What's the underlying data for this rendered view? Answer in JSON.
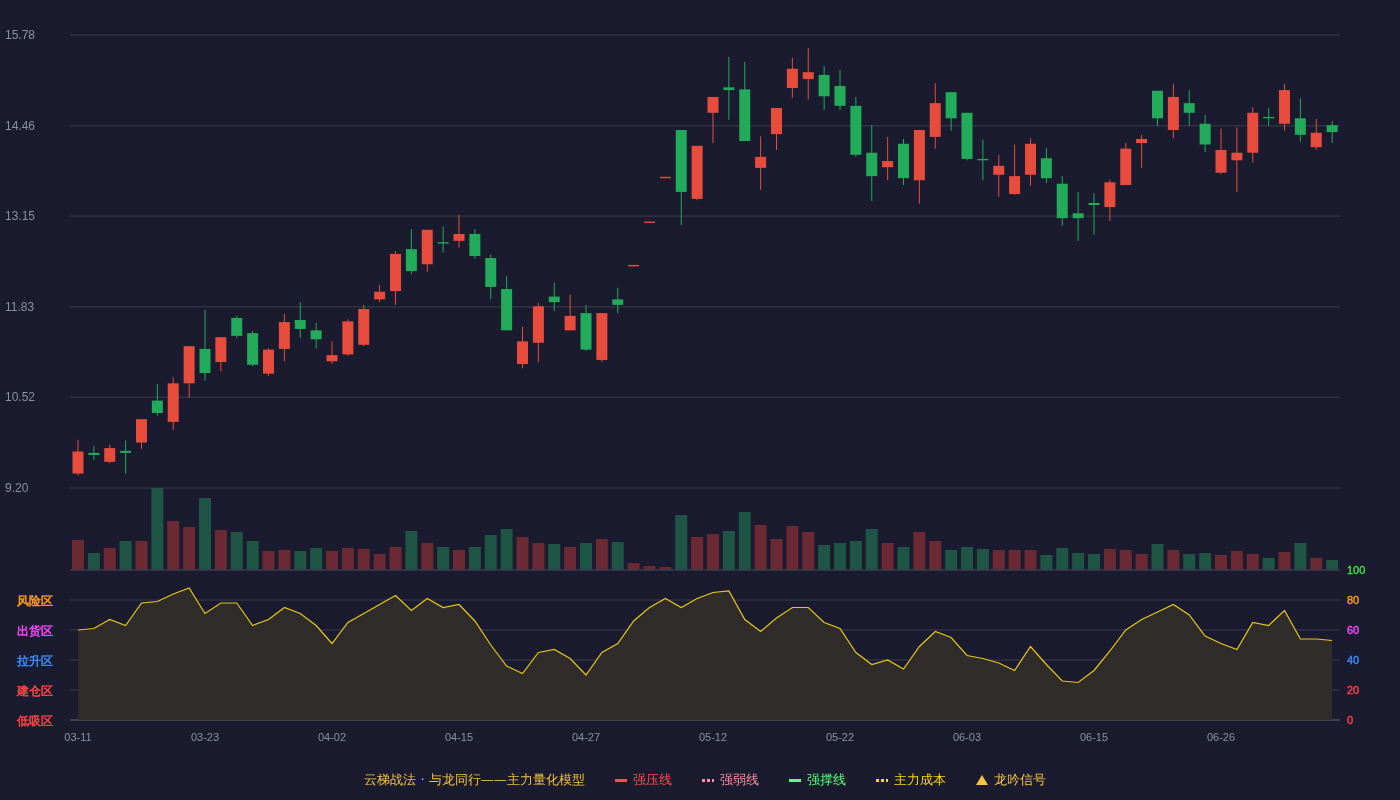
{
  "price_chart": {
    "chart_data": {
      "type": "candlestick",
      "grid": true,
      "ylim": [
        9.2,
        15.78
      ],
      "yticks": [
        {
          "value": 9.2,
          "label": "9.20"
        },
        {
          "value": 10.52,
          "label": "10.52"
        },
        {
          "value": 11.83,
          "label": "11.83"
        },
        {
          "value": 13.15,
          "label": "13.15"
        },
        {
          "value": 14.46,
          "label": "14.46"
        },
        {
          "value": 15.78,
          "label": "15.78"
        }
      ],
      "ohlc": [
        [
          9.41,
          9.9,
          9.38,
          9.73
        ],
        [
          9.71,
          9.81,
          9.61,
          9.68
        ],
        [
          9.58,
          9.83,
          9.56,
          9.78
        ],
        [
          9.74,
          9.89,
          9.41,
          9.71
        ],
        [
          9.86,
          10.2,
          9.77,
          10.2
        ],
        [
          10.47,
          10.71,
          10.25,
          10.29
        ],
        [
          10.16,
          10.81,
          10.04,
          10.72
        ],
        [
          10.72,
          11.26,
          10.51,
          11.26
        ],
        [
          11.22,
          11.79,
          10.76,
          10.87
        ],
        [
          11.03,
          11.39,
          10.89,
          11.39
        ],
        [
          11.67,
          11.7,
          11.38,
          11.41
        ],
        [
          11.45,
          11.48,
          10.97,
          10.99
        ],
        [
          10.86,
          11.23,
          10.83,
          11.21
        ],
        [
          11.22,
          11.73,
          11.04,
          11.61
        ],
        [
          11.64,
          11.9,
          11.38,
          11.51
        ],
        [
          11.49,
          11.6,
          11.23,
          11.36
        ],
        [
          11.04,
          11.33,
          11.0,
          11.13
        ],
        [
          11.14,
          11.65,
          11.12,
          11.62
        ],
        [
          11.28,
          11.86,
          11.26,
          11.8
        ],
        [
          11.94,
          12.15,
          11.9,
          12.05
        ],
        [
          12.06,
          12.64,
          11.86,
          12.6
        ],
        [
          12.67,
          12.96,
          12.31,
          12.35
        ],
        [
          12.45,
          12.95,
          12.34,
          12.95
        ],
        [
          12.77,
          13.0,
          12.62,
          12.75
        ],
        [
          12.79,
          13.17,
          12.69,
          12.89
        ],
        [
          12.89,
          12.96,
          12.53,
          12.57
        ],
        [
          12.54,
          12.59,
          11.94,
          12.12
        ],
        [
          12.09,
          12.28,
          11.49,
          11.49
        ],
        [
          11.0,
          11.54,
          10.94,
          11.33
        ],
        [
          11.31,
          11.89,
          11.03,
          11.84
        ],
        [
          11.98,
          12.18,
          11.77,
          11.9
        ],
        [
          11.49,
          12.01,
          11.49,
          11.7
        ],
        [
          11.74,
          11.86,
          11.19,
          11.21
        ],
        [
          11.06,
          11.74,
          11.03,
          11.74
        ],
        [
          11.94,
          12.11,
          11.74,
          11.86
        ],
        [
          12.42,
          12.44,
          12.42,
          12.44
        ],
        [
          13.05,
          13.07,
          13.05,
          13.07
        ],
        [
          13.7,
          13.72,
          13.7,
          13.72
        ],
        [
          14.4,
          14.4,
          13.02,
          13.5
        ],
        [
          13.4,
          14.17,
          13.38,
          14.17
        ],
        [
          14.65,
          14.88,
          14.21,
          14.88
        ],
        [
          15.02,
          15.46,
          14.55,
          14.98
        ],
        [
          14.99,
          15.39,
          14.24,
          14.24
        ],
        [
          13.85,
          14.31,
          13.53,
          14.01
        ],
        [
          14.34,
          14.72,
          14.11,
          14.72
        ],
        [
          15.01,
          15.45,
          14.87,
          15.29
        ],
        [
          15.14,
          15.59,
          14.84,
          15.24
        ],
        [
          15.2,
          15.33,
          14.69,
          14.89
        ],
        [
          15.04,
          15.27,
          14.69,
          14.75
        ],
        [
          14.75,
          14.88,
          14.01,
          14.04
        ],
        [
          14.07,
          14.47,
          13.37,
          13.73
        ],
        [
          13.86,
          14.3,
          13.67,
          13.95
        ],
        [
          14.2,
          14.27,
          13.6,
          13.7
        ],
        [
          13.67,
          14.4,
          13.33,
          14.4
        ],
        [
          14.3,
          15.08,
          14.13,
          14.79
        ],
        [
          14.95,
          14.95,
          14.39,
          14.57
        ],
        [
          14.65,
          14.65,
          13.96,
          13.98
        ],
        [
          13.98,
          14.26,
          13.67,
          13.96
        ],
        [
          13.75,
          14.04,
          13.43,
          13.88
        ],
        [
          13.47,
          14.19,
          13.46,
          13.73
        ],
        [
          13.75,
          14.28,
          13.59,
          14.2
        ],
        [
          13.99,
          14.14,
          13.63,
          13.7
        ],
        [
          13.62,
          13.73,
          13.01,
          13.12
        ],
        [
          13.19,
          13.5,
          12.79,
          13.12
        ],
        [
          13.34,
          13.48,
          12.88,
          13.31
        ],
        [
          13.28,
          13.68,
          13.08,
          13.64
        ],
        [
          13.6,
          14.21,
          13.6,
          14.13
        ],
        [
          14.21,
          14.33,
          13.85,
          14.27
        ],
        [
          14.97,
          14.97,
          14.46,
          14.57
        ],
        [
          14.4,
          15.07,
          14.28,
          14.88
        ],
        [
          14.79,
          14.98,
          14.46,
          14.65
        ],
        [
          14.49,
          14.62,
          14.08,
          14.19
        ],
        [
          13.78,
          14.42,
          13.76,
          14.11
        ],
        [
          13.96,
          14.44,
          13.5,
          14.07
        ],
        [
          14.07,
          14.73,
          13.93,
          14.65
        ],
        [
          14.59,
          14.72,
          14.46,
          14.57
        ],
        [
          14.49,
          15.07,
          14.39,
          14.98
        ],
        [
          14.57,
          14.86,
          14.23,
          14.33
        ],
        [
          14.15,
          14.56,
          14.11,
          14.36
        ],
        [
          14.47,
          14.53,
          14.21,
          14.37
        ]
      ]
    }
  },
  "indicator": {
    "zones": [
      {
        "label": "风险区",
        "color": "#ff9f1a"
      },
      {
        "label": "出货区",
        "color": "#ff44ff"
      },
      {
        "label": "拉升区",
        "color": "#3d8bff"
      },
      {
        "label": "建仓区",
        "color": "#ff4444"
      },
      {
        "label": "低吸区",
        "color": "#ff4444"
      }
    ],
    "axis_label_colors": [
      {
        "color": "#ff4444"
      },
      {
        "color": "#ff4444"
      },
      {
        "color": "#3d8bff"
      },
      {
        "color": "#ff44ff"
      },
      {
        "color": "#ff9f1a"
      },
      {
        "color": "#44dd44"
      }
    ],
    "chart_data": {
      "type": "area",
      "grid": true,
      "ylim": [
        0,
        100
      ],
      "yticks": [
        0,
        20,
        40,
        60,
        80,
        100
      ],
      "categories": [
        "03-11",
        null,
        null,
        null,
        null,
        null,
        null,
        null,
        "03-23",
        null,
        null,
        null,
        null,
        null,
        null,
        null,
        "04-02",
        null,
        null,
        null,
        null,
        null,
        null,
        null,
        "04-15",
        null,
        null,
        null,
        null,
        null,
        null,
        null,
        "04-27",
        null,
        null,
        null,
        null,
        null,
        null,
        null,
        "05-12",
        null,
        null,
        null,
        null,
        null,
        null,
        null,
        "05-22",
        null,
        null,
        null,
        null,
        null,
        null,
        null,
        "06-03",
        null,
        null,
        null,
        null,
        null,
        null,
        null,
        "06-15",
        null,
        null,
        null,
        null,
        null,
        null,
        null,
        "06-26",
        null,
        null,
        null,
        null,
        null,
        null,
        null
      ],
      "series": [
        {
          "color": "#e6c619",
          "values": [
            60,
            61,
            67,
            63,
            78,
            79,
            84,
            88,
            71,
            78,
            78,
            63,
            67,
            75,
            71,
            63,
            51,
            65,
            71,
            77,
            83,
            73,
            81,
            75,
            77,
            66,
            50,
            36,
            31,
            45,
            47,
            41,
            30,
            45,
            51,
            66,
            75,
            81,
            75,
            81,
            85,
            86,
            67,
            59,
            68,
            75,
            75,
            65,
            61,
            45,
            37,
            40,
            34,
            49,
            59,
            55,
            43,
            41,
            38,
            33,
            49,
            37,
            26,
            25,
            33,
            46,
            60,
            67,
            72,
            77,
            70,
            56,
            51,
            47,
            65,
            63,
            73,
            54,
            54,
            53
          ]
        }
      ]
    }
  },
  "legend": [
    {
      "kind": "title",
      "label": "云梯战法 · 与龙同行——主力量化模型",
      "color": "#f0c040"
    },
    {
      "kind": "solid",
      "label": "强压线",
      "color": "#ff4d4d"
    },
    {
      "kind": "dashed",
      "label": "强弱线",
      "color": "#ff8fa3"
    },
    {
      "kind": "solid",
      "label": "强撑线",
      "color": "#5dff7a"
    },
    {
      "kind": "dashed",
      "label": "主力成本",
      "color": "#ffd700"
    },
    {
      "kind": "triangle",
      "label": "龙吟信号",
      "color": "#f5c542"
    }
  ]
}
